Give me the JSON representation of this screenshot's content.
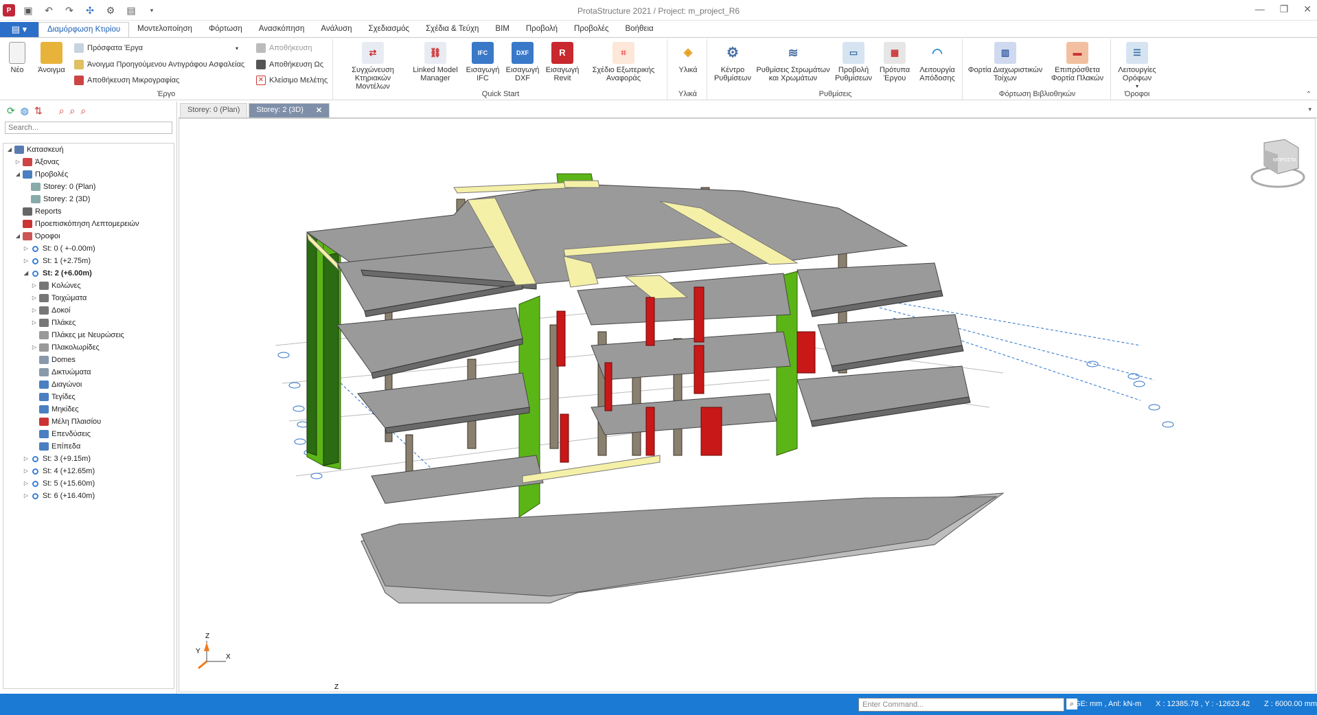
{
  "window": {
    "title": "ProtaStructure 2021 / Project: m_project_R6",
    "controls": [
      "—",
      "❐",
      "✕"
    ]
  },
  "qat": {
    "items": [
      "save-icon",
      "undo-icon",
      "redo-icon",
      "structure-icon",
      "settings-icon",
      "calculator-icon",
      "dropdown-icon"
    ]
  },
  "menu": {
    "file_label": "▤ ▾",
    "tabs": [
      "Διαμόρφωση Κτιρίου",
      "Μοντελοποίηση",
      "Φόρτωση",
      "Ανασκόπηση",
      "Ανάλυση",
      "Σχεδιασμός",
      "Σχέδια & Τεύχη",
      "BIM",
      "Προβολή",
      "Προβολές",
      "Βοήθεια"
    ]
  },
  "ribbon": {
    "project": {
      "label": "Έργο",
      "new": "Νέο",
      "open": "Άνοιγμα",
      "recent": "Πρόσφατα Έργα",
      "open_backup": "Άνοιγμα Προηγούμενου Αντιγράφου Ασφαλείας",
      "save_snapshot": "Αποθήκευση Μικρογραφίας",
      "save": "Αποθήκευση",
      "save_as": "Αποθήκευση Ως",
      "close": "Κλείσιμο Μελέτης"
    },
    "quickstart": {
      "label": "Quick Start",
      "sync": "Συγχώνευση Κτηριακών Μοντέλων",
      "linked": "Linked Model Manager",
      "ifc": "Εισαγωγή IFC",
      "dxf": "Εισαγωγή DXF",
      "revit": "Εισαγωγή Revit",
      "ext": "Σχέδιο Εξωτερικής Αναφοράς"
    },
    "materials": {
      "label": "Υλικά",
      "btn": "Υλικά"
    },
    "settings": {
      "label": "Ρυθμίσεις",
      "center": "Κέντρο Ρυθμίσεων",
      "layers": "Ρυθμίσεις Στρωμάτων και Χρωμάτων",
      "view": "Προβολή Ρυθμίσεων",
      "templates": "Πρότυπα Έργου",
      "performance": "Λειτουργία Απόδοσης"
    },
    "library": {
      "label": "Φόρτωση Βιβλιοθηκών",
      "walls": "Φορτία Διαχωριστικών Τοίχων",
      "slabs": "Επιπρόσθετα Φορτία Πλακών"
    },
    "storeys": {
      "label": "Όροφοι",
      "ops": "Λειτουργίες Ορόφων"
    }
  },
  "panel": {
    "search_placeholder": "Search...",
    "tree": [
      {
        "lvl": 0,
        "tg": "◢",
        "label": "Κατασκευή",
        "icon": "#5a7bb0"
      },
      {
        "lvl": 1,
        "tg": "▷",
        "label": "Άξονας",
        "icon": "#c44"
      },
      {
        "lvl": 1,
        "tg": "◢",
        "label": "Προβολές",
        "icon": "#4a7fc1"
      },
      {
        "lvl": 2,
        "tg": "",
        "label": "Storey: 0 (Plan)",
        "icon": "#8aa"
      },
      {
        "lvl": 2,
        "tg": "",
        "label": "Storey: 2 (3D)",
        "icon": "#8aa"
      },
      {
        "lvl": 1,
        "tg": "",
        "label": "Reports",
        "icon": "#666"
      },
      {
        "lvl": 1,
        "tg": "",
        "label": "Προεπισκόπηση Λεπτομερειών",
        "icon": "#c33"
      },
      {
        "lvl": 1,
        "tg": "◢",
        "label": "Όροφοι",
        "icon": "#c55"
      },
      {
        "lvl": 2,
        "tg": "▷",
        "label": "St: 0 ( +-0.00m)",
        "icon": "#3a7fd5",
        "dot": true
      },
      {
        "lvl": 2,
        "tg": "▷",
        "label": "St: 1 (+2.75m)",
        "icon": "#3a7fd5",
        "dot": true
      },
      {
        "lvl": 2,
        "tg": "◢",
        "label": "St: 2 (+6.00m)",
        "icon": "#3a7fd5",
        "dot": true,
        "bold": true
      },
      {
        "lvl": 3,
        "tg": "▷",
        "label": "Κολώνες",
        "icon": "#777"
      },
      {
        "lvl": 3,
        "tg": "▷",
        "label": "Τοιχώματα",
        "icon": "#777"
      },
      {
        "lvl": 3,
        "tg": "▷",
        "label": "Δοκοί",
        "icon": "#777"
      },
      {
        "lvl": 3,
        "tg": "▷",
        "label": "Πλάκες",
        "icon": "#777"
      },
      {
        "lvl": 3,
        "tg": "",
        "label": "Πλάκες με Νευρώσεις",
        "icon": "#999"
      },
      {
        "lvl": 3,
        "tg": "▷",
        "label": "Πλακολωρίδες",
        "icon": "#999"
      },
      {
        "lvl": 3,
        "tg": "",
        "label": "Domes",
        "icon": "#89a"
      },
      {
        "lvl": 3,
        "tg": "",
        "label": "Δικτυώματα",
        "icon": "#89a"
      },
      {
        "lvl": 3,
        "tg": "",
        "label": "Διαγώνοι",
        "icon": "#4a7fc1"
      },
      {
        "lvl": 3,
        "tg": "",
        "label": "Τεγίδες",
        "icon": "#4a7fc1"
      },
      {
        "lvl": 3,
        "tg": "",
        "label": "Μηκίδες",
        "icon": "#4a7fc1"
      },
      {
        "lvl": 3,
        "tg": "",
        "label": "Μέλη Πλαισίου",
        "icon": "#c33"
      },
      {
        "lvl": 3,
        "tg": "",
        "label": "Επενδύσεις",
        "icon": "#4a7fc1"
      },
      {
        "lvl": 3,
        "tg": "",
        "label": "Επίπεδα",
        "icon": "#4a7fc1"
      },
      {
        "lvl": 2,
        "tg": "▷",
        "label": "St: 3 (+9.15m)",
        "icon": "#3a7fd5",
        "dot": true
      },
      {
        "lvl": 2,
        "tg": "▷",
        "label": "St: 4 (+12.65m)",
        "icon": "#3a7fd5",
        "dot": true
      },
      {
        "lvl": 2,
        "tg": "▷",
        "label": "St: 5 (+15.60m)",
        "icon": "#3a7fd5",
        "dot": true
      },
      {
        "lvl": 2,
        "tg": "▷",
        "label": "St: 6 (+16.40m)",
        "icon": "#3a7fd5",
        "dot": true
      }
    ]
  },
  "doc": {
    "tabs": [
      "Storey: 0 (Plan)",
      "Storey: 2 (3D)"
    ],
    "close_glyph": "✕",
    "more_glyph": "▾"
  },
  "viewport": {
    "axis_labels": {
      "z": "Z",
      "y": "Y",
      "x": "X",
      "z2": "Z"
    },
    "cube_label": "ΜΠΡΟΣΤΑ"
  },
  "status": {
    "command_placeholder": "Enter Command...",
    "units": "GE: mm , Anl: kN-m",
    "coords": "X : 12385.78 , Y : -12623.42",
    "zcoord": "Z : 6000.00 mm"
  },
  "colors": {
    "accent": "#1a7ad4",
    "wall_green": "#5cb517",
    "beam_cream": "#f5f0a8",
    "slab_grey": "#9a9a9a",
    "red_wall": "#c81818"
  }
}
